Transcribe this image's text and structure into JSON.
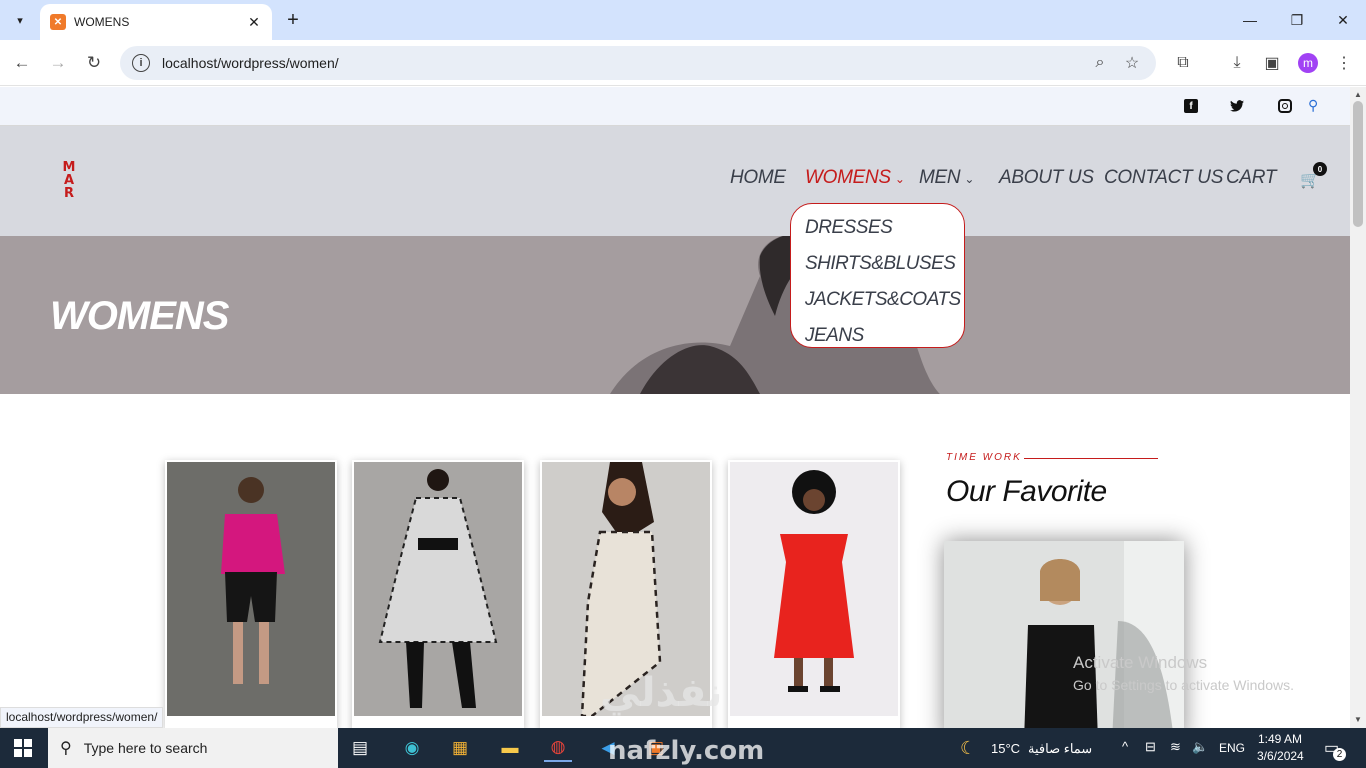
{
  "browser": {
    "tab_title": "WOMENS",
    "url": "localhost/wordpress/women/",
    "profile_initial": "m"
  },
  "topbar": {
    "social": [
      "facebook-icon",
      "twitter-icon",
      "instagram-icon"
    ]
  },
  "site": {
    "logo_letters": [
      "M",
      "A",
      "R"
    ],
    "nav": {
      "home": "HOME",
      "womens": "WOMENS",
      "men": "MEN",
      "about": "ABOUT US",
      "contact": "CONTACT US",
      "cart": "CART",
      "cart_count": "0"
    },
    "dropdown": [
      "DRESSES",
      "SHIRTS&BLUSES",
      "JACKETS&COATS",
      "JEANS"
    ],
    "hero_title": "WOMENS",
    "favorite": {
      "kicker": "TIME WORK",
      "title": "Our Favorite"
    },
    "accent_color": "#c51c1c"
  },
  "products": [
    {
      "name": "pink-top-outfit"
    },
    {
      "name": "zebra-print-dress"
    },
    {
      "name": "animal-print-dress"
    },
    {
      "name": "red-offshoulder-dress"
    }
  ],
  "overlay": {
    "activate_title": "Activate Windows",
    "activate_sub": "Go to Settings to activate Windows.",
    "status_url": "localhost/wordpress/women/",
    "brand_arabic": "نفذلي",
    "brand_latin": "nafzly.com"
  },
  "taskbar": {
    "search_placeholder": "Type here to search",
    "weather_temp": "15°C",
    "weather_desc": "سماء صافية",
    "lang": "ENG",
    "time": "1:49 AM",
    "date": "3/6/2024",
    "notifications": "2"
  }
}
